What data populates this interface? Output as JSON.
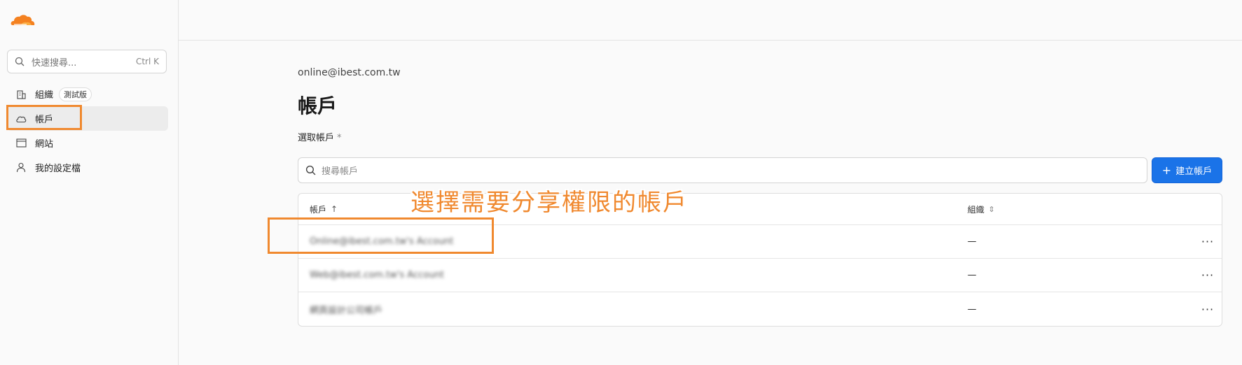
{
  "sidebar": {
    "search": {
      "placeholder": "快速搜尋...",
      "shortcut": "Ctrl K"
    },
    "items": [
      {
        "label": "組織",
        "badge": "測試版",
        "icon": "building-icon"
      },
      {
        "label": "帳戶",
        "icon": "cloud-icon",
        "active": true
      },
      {
        "label": "網站",
        "icon": "browser-window-icon"
      },
      {
        "label": "我的設定檔",
        "icon": "user-icon"
      }
    ]
  },
  "main": {
    "email": "online@ibest.com.tw",
    "title": "帳戶",
    "select_label": "選取帳戶",
    "required_mark": "*",
    "search_placeholder": "搜尋帳戶",
    "create_button": "建立帳戶",
    "table": {
      "columns": [
        {
          "label": "帳戶",
          "sort": "↑"
        },
        {
          "label": "組織",
          "sort": "⇕"
        }
      ],
      "rows": [
        {
          "account": "Online@ibest.com.tw's Account",
          "org": "—",
          "menu": "···"
        },
        {
          "account": "Web@ibest.com.tw's Account",
          "org": "—",
          "menu": "···"
        },
        {
          "account": "網頁設計公司帳戶",
          "org": "—",
          "menu": "···"
        }
      ]
    }
  },
  "annotation": {
    "text": "選擇需要分享權限的帳戶",
    "color": "#f0892f"
  },
  "colors": {
    "brand": "#f48120",
    "primary": "#1a73e8"
  }
}
